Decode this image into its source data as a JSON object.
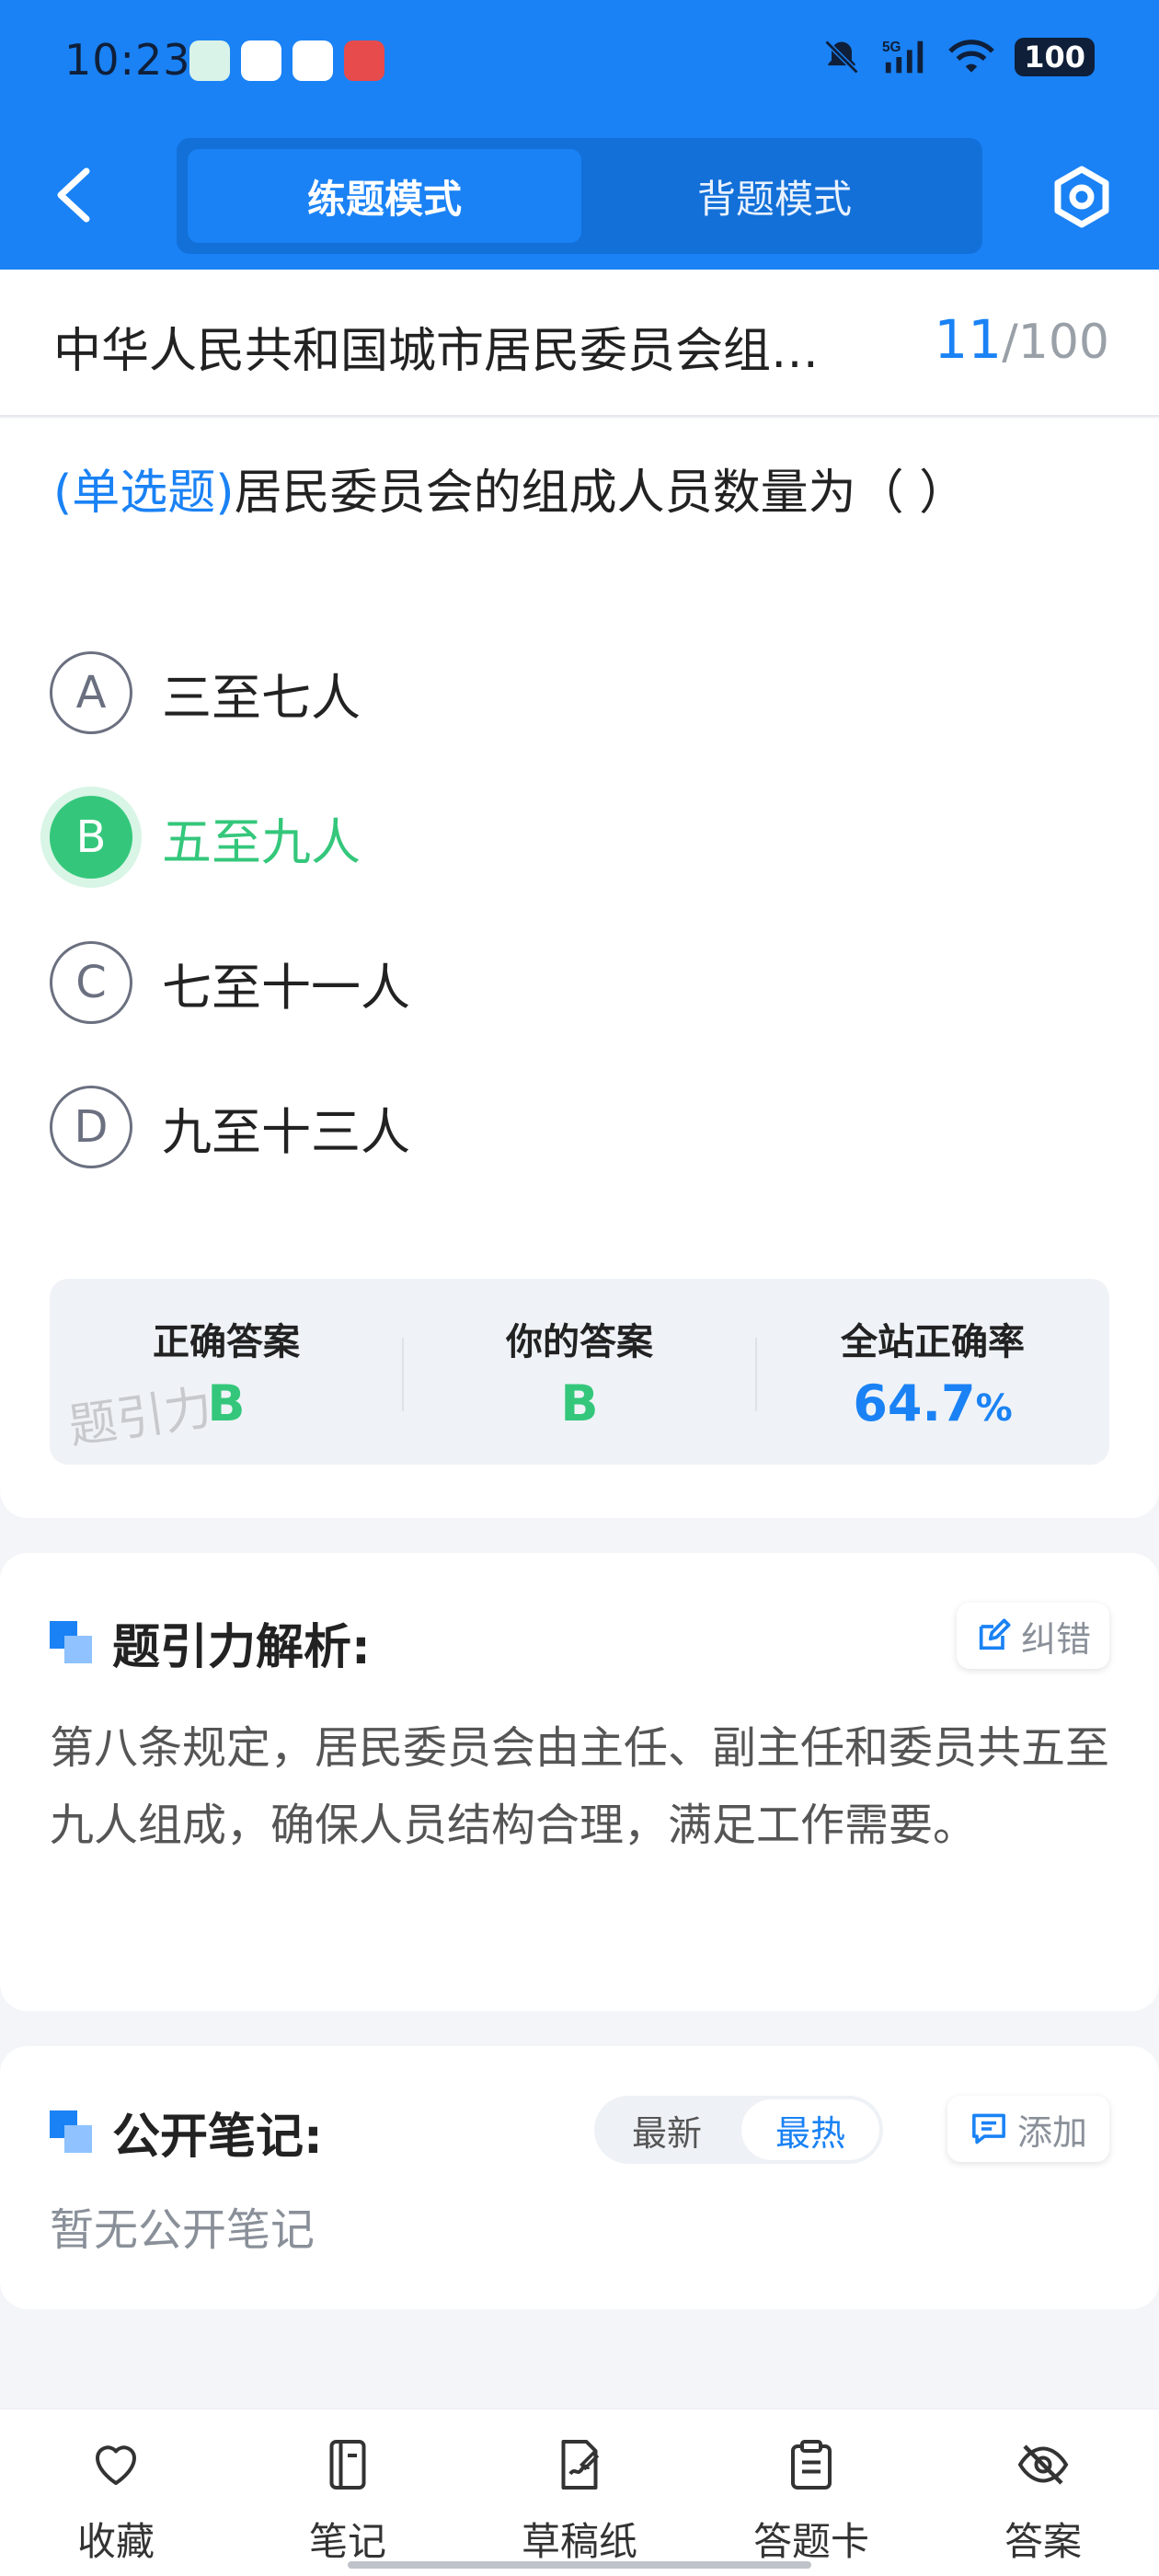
{
  "status": {
    "time": "10:23",
    "network": "5G",
    "battery": "100"
  },
  "header": {
    "tabs": [
      "练题模式",
      "背题模式"
    ]
  },
  "title": {
    "text": "中华人民共和国城市居民委员会组…",
    "current": "11",
    "separator": "/",
    "total": "100"
  },
  "question": {
    "type": "(单选题)",
    "text": "居民委员会的组成人员数量为（ ）",
    "options": [
      {
        "letter": "A",
        "text": "三至七人"
      },
      {
        "letter": "B",
        "text": "五至九人"
      },
      {
        "letter": "C",
        "text": "七至十一人"
      },
      {
        "letter": "D",
        "text": "九至十三人"
      }
    ]
  },
  "answer": {
    "correct_label": "正确答案",
    "correct_value": "B",
    "yours_label": "你的答案",
    "yours_value": "B",
    "rate_label": "全站正确率",
    "rate_value": "64.7",
    "rate_unit": "%",
    "watermark": "题引力"
  },
  "analysis": {
    "title": "题引力解析:",
    "correct_btn": "纠错",
    "text": "第八条规定，居民委员会由主任、副主任和委员共五至九人组成，确保人员结构合理，满足工作需要。"
  },
  "notes": {
    "title": "公开笔记:",
    "sort_options": [
      "最新",
      "最热"
    ],
    "add_btn": "添加",
    "empty_text": "暂无公开笔记"
  },
  "bottom_nav": [
    "收藏",
    "笔记",
    "草稿纸",
    "答题卡",
    "答案"
  ],
  "colors": {
    "primary": "#1a82f5",
    "correct": "#34c77b"
  }
}
